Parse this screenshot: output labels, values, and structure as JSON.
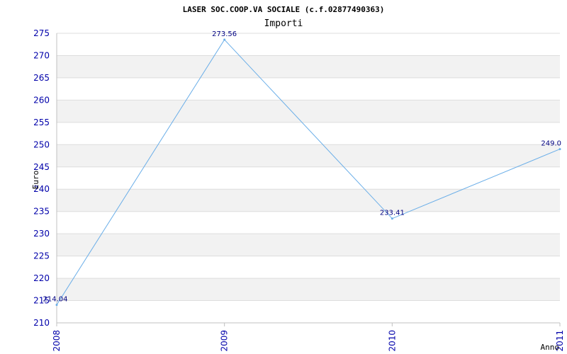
{
  "chart_data": {
    "type": "line",
    "title": "LASER SOC.COOP.VA SOCIALE (c.f.02877490363)",
    "subtitle": "Importi",
    "xlabel": "Anno",
    "ylabel": "Euro",
    "categories": [
      "2008",
      "2009",
      "2010",
      "2011"
    ],
    "series": [
      {
        "values": [
          214.04,
          273.56,
          233.41,
          249.0
        ],
        "labels": [
          "214.04",
          "273.56",
          "233.41",
          "249.0"
        ]
      }
    ],
    "ylim": [
      210,
      275
    ],
    "yticks": [
      210,
      215,
      220,
      225,
      230,
      235,
      240,
      245,
      250,
      255,
      260,
      265,
      270,
      275
    ],
    "grid": true,
    "colors": {
      "line": "#6aaee8",
      "band": "#f2f2f2",
      "gridline": "#dddddd",
      "axis": "#c0c0c0",
      "tick_text": "#0000aa",
      "data_label": "#000080"
    }
  }
}
